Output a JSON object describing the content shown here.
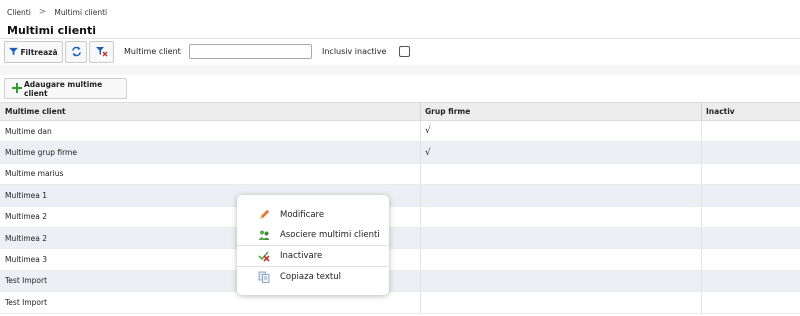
{
  "breadcrumb": {
    "root": "Clienti",
    "separator": ">",
    "current": "Multimi clienti"
  },
  "page": {
    "title": "Multimi clienti"
  },
  "toolbar": {
    "filter_label": "Filtrează",
    "name_label": "Multime client",
    "name_value": "",
    "inactive_label": "Inclusiv inactive",
    "inactive_checked": false
  },
  "actions": {
    "add_label": "Adaugare multime client"
  },
  "grid": {
    "columns": [
      "Multime client",
      "Grup firme",
      "Inactiv"
    ],
    "rows": [
      {
        "name": "Multime dan",
        "grup": "√",
        "inactiv": ""
      },
      {
        "name": "Multime grup firme",
        "grup": "√",
        "inactiv": ""
      },
      {
        "name": "Multime marius",
        "grup": "",
        "inactiv": ""
      },
      {
        "name": "Multimea 1",
        "grup": "",
        "inactiv": ""
      },
      {
        "name": "Multimea 2",
        "grup": "",
        "inactiv": ""
      },
      {
        "name": "Multimea 2",
        "grup": "",
        "inactiv": ""
      },
      {
        "name": "Multimea 3",
        "grup": "",
        "inactiv": ""
      },
      {
        "name": "Test Import",
        "grup": "",
        "inactiv": ""
      },
      {
        "name": "Test Import",
        "grup": "",
        "inactiv": ""
      }
    ]
  },
  "context_menu": {
    "items": [
      {
        "label": "Modificare",
        "icon": "pencil-icon"
      },
      {
        "label": "Asociere multimi clienti",
        "icon": "users-group-icon"
      },
      {
        "label": "Inactivare",
        "icon": "disable-icon"
      },
      {
        "label": "Copiaza textul",
        "icon": "copy-icon"
      }
    ]
  },
  "colors": {
    "header_bg": "#ededed",
    "alt_row_bg": "#eceff3",
    "add_icon": "#2e9e2e",
    "filter_icon": "#1f5fb8",
    "clear_icon": "#c0392b"
  }
}
